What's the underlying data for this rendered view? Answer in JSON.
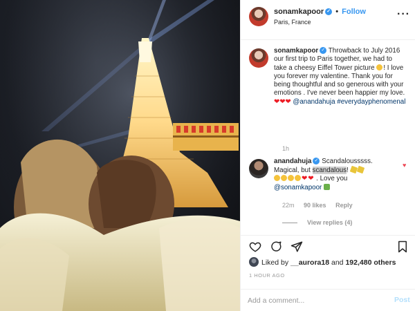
{
  "post": {
    "username": "sonamkapoor",
    "verified_glyph": "✓",
    "dot": "•",
    "follow_label": "Follow",
    "location": "Paris, France",
    "more_icon": "···"
  },
  "caption": {
    "username": "sonamkapoor",
    "text": "Throwback to July 2016 our first trip to Paris together, we had to take a cheesy Eiffel Tower picture",
    "text2": "! I love you forever my valentine. Thank you for being thoughtful and so generous with your emotions . I've never been happier my love.",
    "hearts": "❤❤❤",
    "mention": "@anandahuja",
    "hashtag": "#everydayphenomenal",
    "time": "1h"
  },
  "reply": {
    "username": "anandahuja",
    "text_before": "Scandalousssss. Magical, but ",
    "highlight": "scandalous",
    "text_after": "!",
    "hearts": "❤❤",
    "love_you": ". Love you",
    "mention": "@sonamkapoor",
    "time": "22m",
    "likes": "90 likes",
    "reply_label": "Reply",
    "view_replies": "View replies (4)"
  },
  "likes": {
    "prefix": "Liked by",
    "user": "__aurora18",
    "and": "and",
    "count": "192,480 others"
  },
  "time_ago": "1 HOUR AGO",
  "comment_input": {
    "placeholder": "Add a comment...",
    "value": "",
    "post_label": "Post"
  },
  "icons": {
    "like": "heart-icon",
    "comment": "comment-icon",
    "share": "share-icon",
    "save": "bookmark-icon"
  },
  "colors": {
    "link_blue": "#3897f0",
    "post_disabled": "#b2dffc",
    "heart_red": "#ed1c24",
    "muted": "#999999"
  }
}
